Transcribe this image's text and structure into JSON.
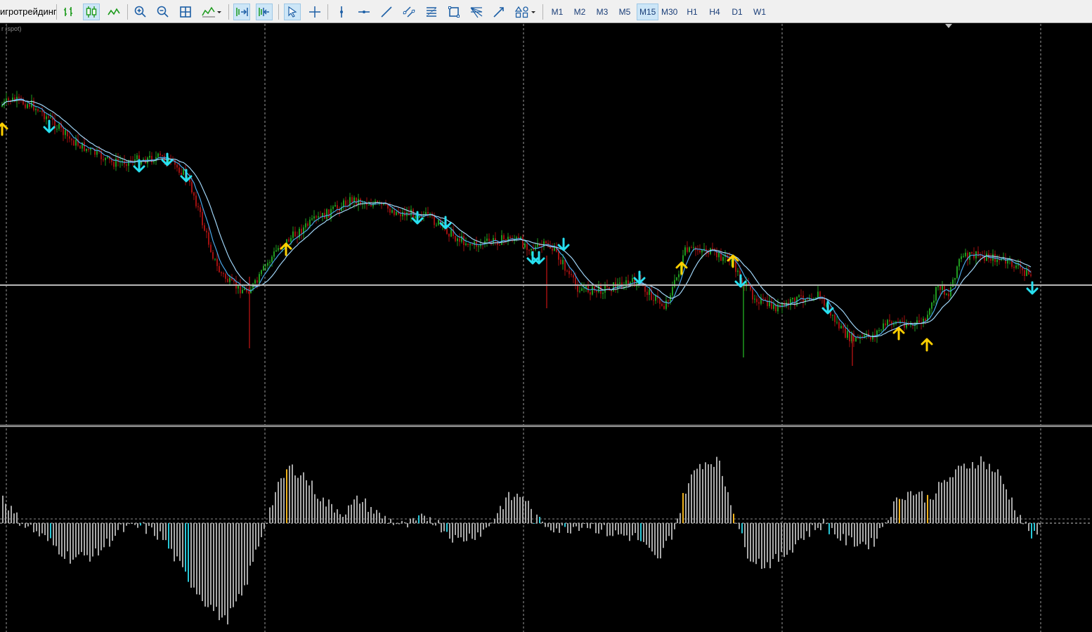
{
  "toolbar": {
    "left_label": "игротрейдинг",
    "buttons": [
      {
        "name": "bar-chart-icon"
      },
      {
        "name": "candlestick-chart-icon",
        "active": true
      },
      {
        "name": "line-chart-icon"
      },
      {
        "name": "zoom-in-icon"
      },
      {
        "name": "zoom-out-icon"
      },
      {
        "name": "tile-windows-icon"
      },
      {
        "name": "indicators-dropdown-icon"
      },
      {
        "name": "auto-scroll-icon",
        "active": true
      },
      {
        "name": "chart-shift-icon",
        "active": true
      },
      {
        "name": "cursor-icon",
        "active": true
      },
      {
        "name": "crosshair-icon"
      },
      {
        "name": "vertical-line-icon"
      },
      {
        "name": "horizontal-line-icon"
      },
      {
        "name": "trendline-icon"
      },
      {
        "name": "equidistant-channel-icon"
      },
      {
        "name": "fibonacci-icon"
      },
      {
        "name": "rectangle-icon"
      },
      {
        "name": "gann-fan-icon"
      },
      {
        "name": "arrow-line-icon"
      },
      {
        "name": "shapes-dropdown-icon"
      }
    ],
    "timeframes": [
      "M1",
      "M2",
      "M3",
      "M5",
      "M15",
      "M30",
      "H1",
      "H4",
      "D1",
      "W1"
    ],
    "active_timeframe": "M15"
  },
  "chart": {
    "symbol_label": "r (spot)",
    "colors": {
      "background": "#000000",
      "bull_candle": "#1f9a1f",
      "bear_candle": "#a01010",
      "ma_fast": "#4aa6e8",
      "ma_slow": "#9fd4f6",
      "arrow_buy": "#ffd000",
      "arrow_sell": "#27e0f0",
      "grid": "#9a9a9a",
      "level_line": "#b8b8b8",
      "histogram": "#a8a8a8",
      "histogram_buy": "#f0b21b",
      "histogram_sell": "#28c8d8"
    }
  }
}
